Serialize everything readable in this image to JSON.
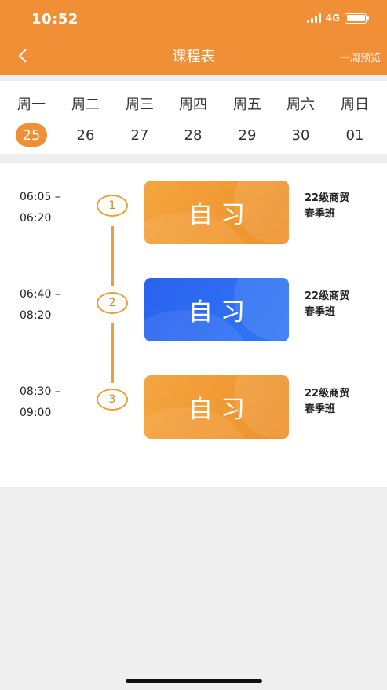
{
  "status_bar": {
    "time": "10:52",
    "network": "4G"
  },
  "header": {
    "title": "课程表",
    "week_link": "一周预览"
  },
  "week": [
    {
      "weekday": "周一",
      "date": "25",
      "active": true
    },
    {
      "weekday": "周二",
      "date": "26",
      "active": false
    },
    {
      "weekday": "周三",
      "date": "27",
      "active": false
    },
    {
      "weekday": "周四",
      "date": "28",
      "active": false
    },
    {
      "weekday": "周五",
      "date": "29",
      "active": false
    },
    {
      "weekday": "周六",
      "date": "30",
      "active": false
    },
    {
      "weekday": "周日",
      "date": "01",
      "active": false
    }
  ],
  "schedule": [
    {
      "index": "1",
      "start": "06:05 –",
      "end": "06:20",
      "course": "自习",
      "class_line1": "22级商贸",
      "class_line2": "春季班",
      "color": "orange"
    },
    {
      "index": "2",
      "start": "06:40 –",
      "end": "08:20",
      "course": "自习",
      "class_line1": "22级商贸",
      "class_line2": "春季班",
      "color": "blue"
    },
    {
      "index": "3",
      "start": "08:30 –",
      "end": "09:00",
      "course": "自习",
      "class_line1": "22级商贸",
      "class_line2": "春季班",
      "color": "orange"
    }
  ],
  "icons": {
    "back": "chevron-left-icon",
    "signal": "signal-icon",
    "battery": "battery-icon"
  },
  "colors": {
    "accent": "#f08f35",
    "blue_card": "#2a62ee",
    "timeline": "#e6a235"
  }
}
